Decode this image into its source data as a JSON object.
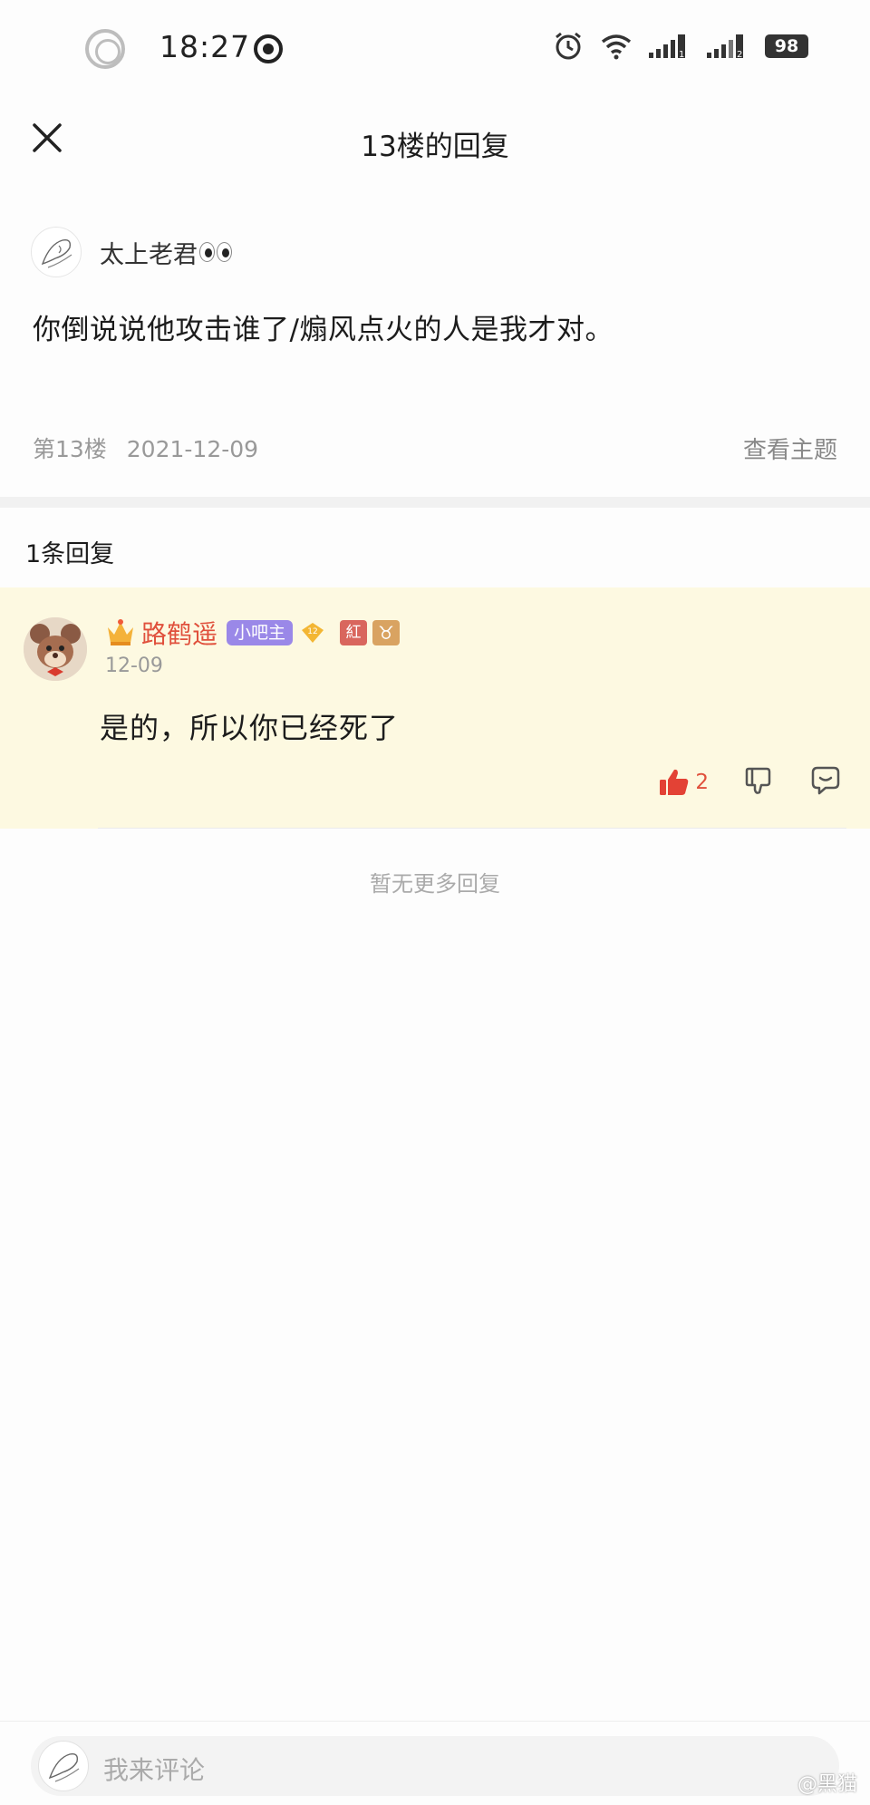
{
  "status_bar": {
    "time": "18:27",
    "battery": "98",
    "sim1": "1",
    "sim2": "2"
  },
  "header": {
    "title": "13楼的回复"
  },
  "post": {
    "author": "太上老君",
    "body": "你倒说说他攻击谁了/煽风点火的人是我才对。",
    "floor": "第13楼",
    "date": "2021-12-09",
    "view_topic": "查看主题"
  },
  "replies_header": "1条回复",
  "reply": {
    "author": "路鹤遥",
    "badge_owner": "小吧主",
    "level": "12",
    "badge_red": "紅",
    "badge_zodiac": "♉",
    "date": "12-09",
    "text": "是的，所以你已经死了",
    "likes": "2"
  },
  "no_more_text": "暂无更多回复",
  "comment_input": {
    "placeholder": "我来评论"
  },
  "watermark": "@黑猫"
}
